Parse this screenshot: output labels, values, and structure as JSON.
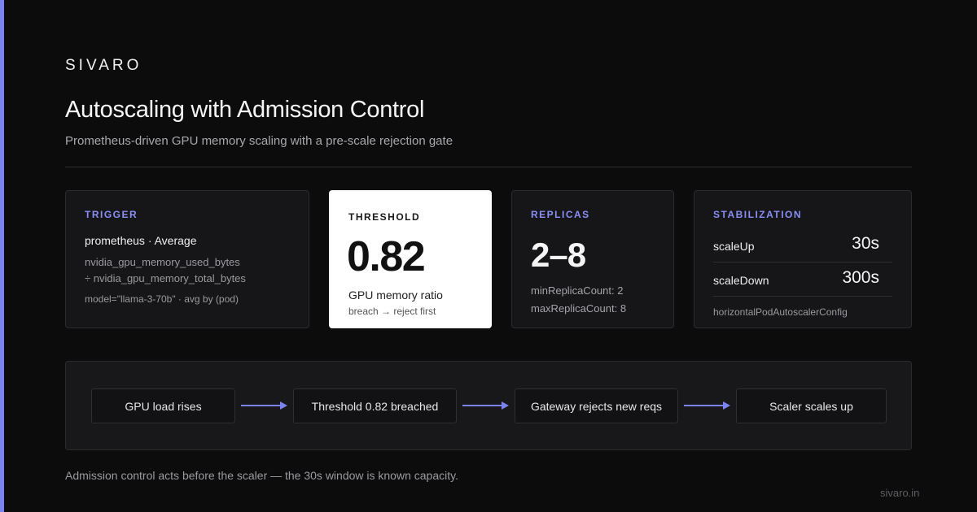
{
  "brand": "SIVARO",
  "title": "Autoscaling with Admission Control",
  "subtitle": "Prometheus-driven GPU memory scaling with a pre-scale rejection gate",
  "cards": {
    "trigger": {
      "label": "TRIGGER",
      "main": "prometheus · Average",
      "query_line1": "nvidia_gpu_memory_used_bytes",
      "query_line2": "÷ nvidia_gpu_memory_total_bytes",
      "query_line3": "model=\"llama-3-70b\" · avg by (pod)"
    },
    "threshold": {
      "label": "THRESHOLD",
      "value": "0.82",
      "caption": "GPU memory ratio",
      "note": "breach → reject first"
    },
    "replicas": {
      "label": "REPLICAS",
      "value": "2–8",
      "min": "minReplicaCount: 2",
      "max": "maxReplicaCount: 8"
    },
    "stabilization": {
      "label": "STABILIZATION",
      "rows": [
        {
          "key": "scaleUp",
          "value": "30s"
        },
        {
          "key": "scaleDown",
          "value": "300s"
        }
      ],
      "footer": "horizontalPodAutoscalerConfig"
    }
  },
  "flow": {
    "steps": [
      "GPU load rises",
      "Threshold 0.82 breached",
      "Gateway rejects new reqs",
      "Scaler scales up"
    ]
  },
  "footnote": "Admission control acts before the scaler — the 30s window is known capacity.",
  "site": "sivaro.in",
  "colors": {
    "background": "#0c0c0d",
    "accent": "#7b83f0",
    "card": "#161618",
    "highlight_card": "#ffffff"
  },
  "icons": {
    "arrow": "arrow-right-icon"
  }
}
